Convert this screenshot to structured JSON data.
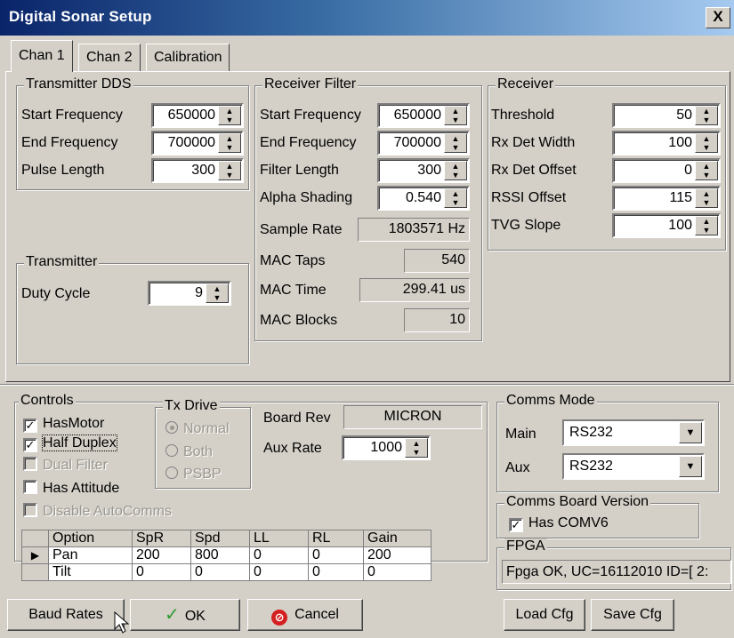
{
  "window": {
    "title": "Digital Sonar Setup",
    "close_label": "X"
  },
  "tabs": [
    {
      "label": "Chan 1"
    },
    {
      "label": "Chan 2"
    },
    {
      "label": "Calibration"
    }
  ],
  "transmitter_dds": {
    "legend": "Transmitter DDS",
    "start_frequency": {
      "label": "Start Frequency",
      "value": "650000"
    },
    "end_frequency": {
      "label": "End Frequency",
      "value": "700000"
    },
    "pulse_length": {
      "label": "Pulse Length",
      "value": "300"
    }
  },
  "transmitter": {
    "legend": "Transmitter",
    "duty_cycle": {
      "label": "Duty Cycle",
      "value": "9"
    }
  },
  "receiver_filter": {
    "legend": "Receiver Filter",
    "start_frequency": {
      "label": "Start Frequency",
      "value": "650000"
    },
    "end_frequency": {
      "label": "End Frequency",
      "value": "700000"
    },
    "filter_length": {
      "label": "Filter Length",
      "value": "300"
    },
    "alpha_shading": {
      "label": "Alpha Shading",
      "value": "0.540"
    },
    "sample_rate": {
      "label": "Sample Rate",
      "value": "1803571 Hz"
    },
    "mac_taps": {
      "label": "MAC Taps",
      "value": "540"
    },
    "mac_time": {
      "label": "MAC Time",
      "value": "299.41 us"
    },
    "mac_blocks": {
      "label": "MAC Blocks",
      "value": "10"
    }
  },
  "receiver": {
    "legend": "Receiver",
    "threshold": {
      "label": "Threshold",
      "value": "50"
    },
    "rx_det_width": {
      "label": "Rx Det Width",
      "value": "100"
    },
    "rx_det_offset": {
      "label": "Rx Det Offset",
      "value": "0"
    },
    "rssi_offset": {
      "label": "RSSI Offset",
      "value": "115"
    },
    "tvg_slope": {
      "label": "TVG Slope",
      "value": "100"
    }
  },
  "controls": {
    "legend": "Controls",
    "has_motor": {
      "label": "HasMotor",
      "checked": true
    },
    "half_duplex": {
      "label": "Half Duplex",
      "checked": true
    },
    "dual_filter": {
      "label": "Dual Filter",
      "checked": false
    },
    "has_attitude": {
      "label": "Has Attitude",
      "checked": false
    },
    "disable_autocomms": {
      "label": "Disable AutoComms",
      "checked": false
    },
    "tx_drive": {
      "legend": "Tx Drive",
      "options": [
        "Normal",
        "Both",
        "PSBP"
      ],
      "selected": "Normal"
    },
    "board_rev": {
      "label": "Board Rev",
      "value": "MICRON"
    },
    "aux_rate": {
      "label": "Aux Rate",
      "value": "1000"
    },
    "grid": {
      "headers": [
        "Option",
        "SpR",
        "Spd",
        "LL",
        "RL",
        "Gain"
      ],
      "rows": [
        [
          "Pan",
          "200",
          "800",
          "0",
          "0",
          "200"
        ],
        [
          "Tilt",
          "0",
          "0",
          "0",
          "0",
          "0"
        ]
      ]
    }
  },
  "comms_mode": {
    "legend": "Comms Mode",
    "main": {
      "label": "Main",
      "value": "RS232"
    },
    "aux": {
      "label": "Aux",
      "value": "RS232"
    }
  },
  "comms_board_version": {
    "legend": "Comms Board Version",
    "has_comv6": {
      "label": "Has COMV6",
      "checked": true
    }
  },
  "fpga": {
    "legend": "FPGA",
    "status": "Fpga OK, UC=16112010 ID=[ 2:"
  },
  "buttons": {
    "baud_rates": "Baud Rates",
    "ok": "OK",
    "cancel": "Cancel",
    "load_cfg": "Load Cfg",
    "save_cfg": "Save Cfg"
  },
  "colors": {
    "titlebar_start": "#0a246a",
    "face": "#d4d0c8",
    "ok_check": "#2e9a2e",
    "cancel_icon": "#d42020"
  }
}
